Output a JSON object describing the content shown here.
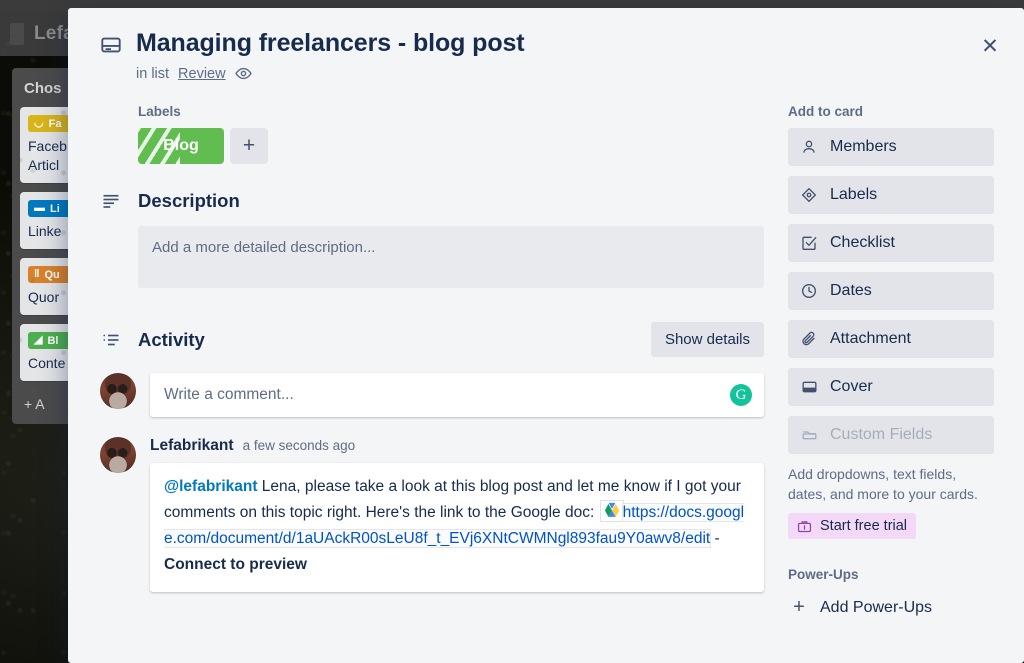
{
  "board": {
    "header_title": "Lefa",
    "list_title": "Chos",
    "add_card_label": "+ A",
    "cards": [
      {
        "label_text": "Fa",
        "label_color": "#d9b51c",
        "label_icon": "facebook-glyph",
        "title": "Faceb"
      },
      {
        "label_text": "Li",
        "label_color": "#0079bf",
        "label_icon": "linkedin-glyph",
        "title": "Linke"
      },
      {
        "label_text": "Qu",
        "label_color": "#d9822b",
        "label_icon": "quora-glyph",
        "title": "Quor"
      },
      {
        "label_text": "Bl",
        "label_color": "#4caf50",
        "label_icon": "blog-glyph",
        "title": "Conte"
      }
    ],
    "card_titles_extra": [
      "Articl"
    ]
  },
  "modal": {
    "close_label": "✕",
    "title": "Managing freelancers - blog post",
    "subtitle_prefix": "in list",
    "subtitle_list": "Review",
    "labels": {
      "heading": "Labels",
      "chips": [
        {
          "text": "Blog",
          "color": "#61bd4f"
        }
      ],
      "add_label": "+"
    },
    "description": {
      "heading": "Description",
      "placeholder": "Add a more detailed description..."
    },
    "activity": {
      "heading": "Activity",
      "show_details_label": "Show details",
      "comment_placeholder": "Write a comment...",
      "grammarly_label": "G",
      "items": [
        {
          "author": "Lefabrikant",
          "time": "a few seconds ago",
          "mention": "@lefabrikant",
          "text_before_link": " Lena, please take a look at this blog post and let me know if I got your comments on this topic right. Here's the link to the Google doc: ",
          "link_url": "https://docs.google.com/document/d/1aUAckR00sLeU8f_t_EVj6XNtCWMNgl893fau9Y0awv8/edit",
          "link_suffix": " - ",
          "connect_preview_label": "Connect to preview"
        }
      ]
    }
  },
  "sidebar": {
    "add_to_card_heading": "Add to card",
    "buttons": [
      {
        "label": "Members",
        "icon": "person-icon",
        "disabled": false
      },
      {
        "label": "Labels",
        "icon": "label-tag-icon",
        "disabled": false
      },
      {
        "label": "Checklist",
        "icon": "checkbox-icon",
        "disabled": false
      },
      {
        "label": "Dates",
        "icon": "clock-icon",
        "disabled": false
      },
      {
        "label": "Attachment",
        "icon": "paperclip-icon",
        "disabled": false
      },
      {
        "label": "Cover",
        "icon": "cover-icon",
        "disabled": false
      },
      {
        "label": "Custom Fields",
        "icon": "custom-fields-icon",
        "disabled": true
      }
    ],
    "custom_fields_note": "Add dropdowns, text fields, dates, and more to your cards.",
    "start_free_trial_label": "Start free trial",
    "power_ups_heading": "Power-Ups",
    "add_power_ups_label": "Add Power-Ups"
  },
  "colors": {
    "modal_bg": "#f4f5f7",
    "text_primary": "#172b4d",
    "text_muted": "#5e6c84",
    "label_green": "#61bd4f",
    "link_blue": "#0052cc",
    "mention_blue": "#0079bf",
    "grammarly_green": "#15c39a",
    "trial_purple": "#f3d8f7"
  }
}
